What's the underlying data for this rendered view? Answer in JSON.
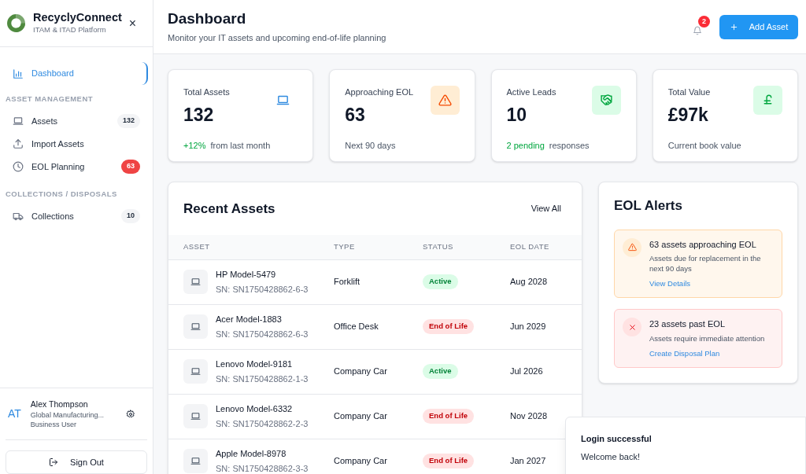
{
  "sidebar": {
    "brand": "RecyclyConnect",
    "tagline": "ITAM & ITAD Platform",
    "close": "×",
    "sections": [
      {
        "items": [
          {
            "label": "Dashboard",
            "kind": "chart",
            "selected": true
          }
        ]
      },
      {
        "heading": "ASSET MANAGEMENT",
        "items": [
          {
            "label": "Assets",
            "kind": "laptop",
            "selected": false,
            "badge": {
              "text": "132",
              "color": "#f3f4f6"
            }
          },
          {
            "label": "Import Assets",
            "kind": "upload",
            "selected": false
          },
          {
            "label": "EOL Planning",
            "kind": "clock",
            "selected": false,
            "badge": {
              "text": "63",
              "color": "#ef4444"
            }
          }
        ]
      },
      {
        "heading": "COLLECTIONS / DISPOSALS",
        "items": [
          {
            "label": "Collections",
            "kind": "truck",
            "selected": false,
            "badge": {
              "text": "10",
              "color": "#f3f4f6"
            }
          }
        ]
      }
    ],
    "user": {
      "initials": "AT",
      "name": "Alex Thompson",
      "company": "Global Manufacturing...",
      "role": "Business User"
    },
    "sign_out": "Sign Out"
  },
  "header": {
    "title": "Dashboard",
    "subtitle": "Monitor your IT assets and upcoming end-of-life planning",
    "notifications": "2",
    "add_button": "Add Asset"
  },
  "stats": [
    {
      "label": "Total Assets",
      "value": "132",
      "kind": "laptop",
      "note_highlight": "+12%",
      "note": "from last month"
    },
    {
      "label": "Approaching EOL",
      "value": "63",
      "kind": "warning",
      "note": "Next 90 days"
    },
    {
      "label": "Active Leads",
      "value": "10",
      "kind": "handshake",
      "note_highlight": "2 pending",
      "note": "responses"
    },
    {
      "label": "Total Value",
      "value": "£97k",
      "kind": "pound",
      "note": "Current book value"
    }
  ],
  "recent_assets": {
    "title": "Recent Assets",
    "view_all": "View All",
    "columns": [
      "ASSET",
      "TYPE",
      "STATUS",
      "EOL DATE"
    ],
    "rows": [
      {
        "name": "HP Model-5479",
        "serial": "SN: SN1750428862-6-3",
        "type": "Forklift",
        "status": "Active",
        "kind": "active",
        "eol": "Aug 2028"
      },
      {
        "name": "Acer Model-1883",
        "serial": "SN: SN1750428862-6-3",
        "type": "Office Desk",
        "status": "End of Life",
        "kind": "end_of_life",
        "eol": "Jun 2029"
      },
      {
        "name": "Lenovo Model-9181",
        "serial": "SN: SN1750428862-1-3",
        "type": "Company Car",
        "status": "Active",
        "kind": "active",
        "eol": "Jul 2026"
      },
      {
        "name": "Lenovo Model-6332",
        "serial": "SN: SN1750428862-2-3",
        "type": "Company Car",
        "status": "End of Life",
        "kind": "end_of_life",
        "eol": "Nov 2028"
      },
      {
        "name": "Apple Model-8978",
        "serial": "SN: SN1750428862-3-3",
        "type": "Company Car",
        "status": "End of Life",
        "kind": "end_of_life",
        "eol": "Jan 2027"
      }
    ]
  },
  "eol_alerts": {
    "title": "EOL Alerts",
    "alerts": [
      {
        "kind": "warning",
        "title": "63 assets approaching EOL",
        "text": "Assets due for replacement in the next 90 days",
        "link": "View Details"
      },
      {
        "kind": "danger",
        "title": "23 assets past EOL",
        "text": "Assets require immediate attention",
        "link": "Create Disposal Plan"
      }
    ]
  },
  "toast": {
    "title": "Login successful",
    "message": "Welcome back!"
  }
}
